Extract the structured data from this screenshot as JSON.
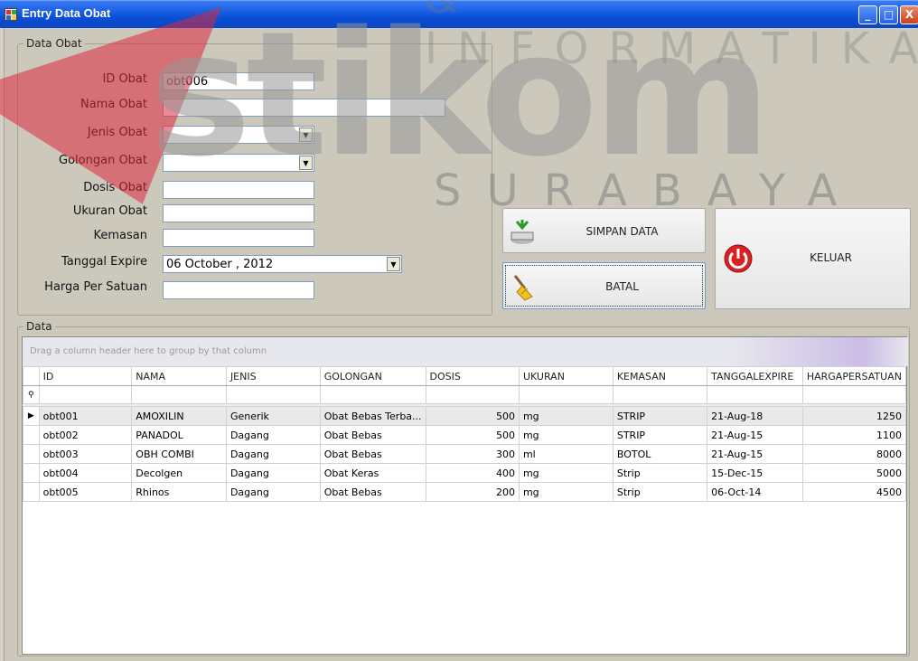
{
  "window": {
    "title": "Entry Data Obat",
    "controls": [
      "_",
      "□",
      "X"
    ]
  },
  "watermark": {
    "word": "stikom",
    "sub": "SURABAYA",
    "top": "& INFORMATIKA"
  },
  "form": {
    "group_title": "Data Obat",
    "fields": {
      "id_label": "ID Obat",
      "id_value": "obt006",
      "nama_label": "Nama Obat",
      "nama_value": "",
      "jenis_label": "Jenis Obat",
      "jenis_value": "",
      "golongan_label": "Golongan Obat",
      "golongan_value": "",
      "dosis_label": "Dosis Obat",
      "dosis_value": "",
      "ukuran_label": "Ukuran Obat",
      "ukuran_value": "",
      "kemasan_label": "Kemasan",
      "kemasan_value": "",
      "expire_label": "Tanggal Expire",
      "expire_value": "06  October , 2012",
      "harga_label": "Harga Per Satuan",
      "harga_value": ""
    }
  },
  "buttons": {
    "simpan": "SIMPAN DATA",
    "batal": "BATAL",
    "keluar": "KELUAR"
  },
  "grid": {
    "group_title": "Data",
    "group_hint": "Drag a column header here to group by that column",
    "columns": [
      "ID",
      "NAMA",
      "JENIS",
      "GOLONGAN",
      "DOSIS",
      "UKURAN",
      "KEMASAN",
      "TANGGALEXPIRE",
      "HARGAPERSATUAN"
    ],
    "rows": [
      [
        "obt001",
        "AMOXILIN",
        "Generik",
        "Obat Bebas Terba...",
        "500",
        "mg",
        "STRIP",
        "21-Aug-18",
        "1250"
      ],
      [
        "obt002",
        "PANADOL",
        "Dagang",
        "Obat Bebas",
        "500",
        "mg",
        "STRIP",
        "21-Aug-15",
        "1100"
      ],
      [
        "obt003",
        "OBH COMBI",
        "Dagang",
        "Obat Bebas",
        "300",
        "ml",
        "BOTOL",
        "21-Aug-15",
        "8000"
      ],
      [
        "obt004",
        "Decolgen",
        "Dagang",
        "Obat Keras",
        "400",
        "mg",
        "Strip",
        "15-Dec-15",
        "5000"
      ],
      [
        "obt005",
        "Rhinos",
        "Dagang",
        "Obat Bebas",
        "200",
        "mg",
        "Strip",
        "06-Oct-14",
        "4500"
      ]
    ]
  }
}
